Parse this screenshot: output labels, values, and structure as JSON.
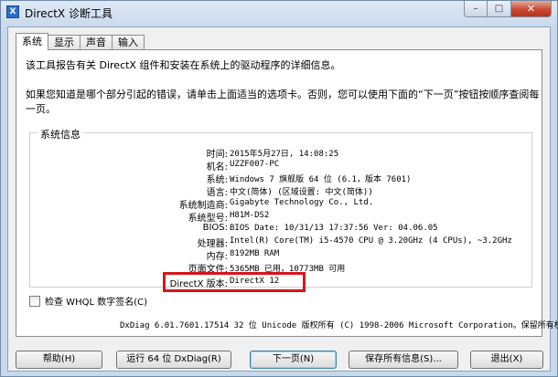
{
  "window": {
    "title": "DirectX 诊断工具",
    "icon": "directx-app-icon"
  },
  "title_buttons": {
    "minimize": "–",
    "maximize": "□",
    "close": "✕"
  },
  "tabs": [
    {
      "label": "系统"
    },
    {
      "label": "显示"
    },
    {
      "label": "声音"
    },
    {
      "label": "输入"
    }
  ],
  "intro": {
    "line1": "该工具报告有关 DirectX 组件和安装在系统上的驱动程序的详细信息。",
    "line2": "如果您知道是哪个部分引起的错误，请单击上面适当的选项卡。否则，您可以使用下面的“下一页”按钮按顺序查阅每一页。"
  },
  "system_info": {
    "group_label": "系统信息",
    "rows": [
      {
        "label": "时间:",
        "value": "2015年5月27日, 14:08:25"
      },
      {
        "label": "机名:",
        "value": "UZZF007-PC"
      },
      {
        "label": "系统:",
        "value": "Windows 7 旗舰版 64 位 (6.1，版本 7601)"
      },
      {
        "label": "语言:",
        "value": "中文(简体) (区域设置: 中文(简体))"
      },
      {
        "label": "系统制造商:",
        "value": "Gigabyte Technology Co., Ltd."
      },
      {
        "label": "系统型号:",
        "value": "H81M-DS2"
      },
      {
        "label": "BIOS:",
        "value": "BIOS Date: 10/31/13 17:37:56 Ver: 04.06.05"
      },
      {
        "label": "处理器:",
        "value": "Intel(R) Core(TM) i5-4570 CPU @ 3.20GHz (4 CPUs), ~3.2GHz"
      },
      {
        "label": "内存:",
        "value": "8192MB RAM"
      },
      {
        "label": "页面文件:",
        "value": "5365MB 已用，10773MB 可用"
      },
      {
        "label": "DirectX 版本:",
        "value": "DirectX 12"
      }
    ]
  },
  "whql": {
    "label": "检查 WHQL 数字签名(C)",
    "checked": false
  },
  "copyright": "DxDiag 6.01.7601.17514 32 位 Unicode 版权所有 (C) 1998-2006 Microsoft Corporation。保留所有权",
  "buttons": {
    "help": "帮助(H)",
    "run64": "运行 64 位 DxDiag(R)",
    "next": "下一页(N)",
    "save": "保存所有信息(S)...",
    "exit": "退出(X)"
  },
  "colors": {
    "highlight": "#d8141b",
    "title_bg": "#c8d9ec",
    "close_btn": "#c84a33"
  }
}
